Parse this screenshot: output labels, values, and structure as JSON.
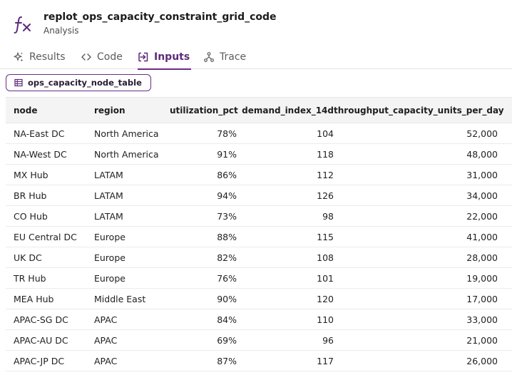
{
  "header": {
    "title": "replot_ops_capacity_constraint_grid_code",
    "subtitle": "Analysis",
    "icon": "function-fx-icon"
  },
  "tabs": [
    {
      "label": "Results",
      "icon": "sparkle-icon",
      "active": false
    },
    {
      "label": "Code",
      "icon": "code-icon",
      "active": false
    },
    {
      "label": "Inputs",
      "icon": "input-icon",
      "active": true
    },
    {
      "label": "Trace",
      "icon": "trace-icon",
      "active": false
    }
  ],
  "input_chip": {
    "label": "ops_capacity_node_table",
    "icon": "table-icon"
  },
  "table": {
    "columns": [
      "node",
      "region",
      "utilization_pct",
      "demand_index_14d",
      "throughput_capacity_units_per_day"
    ],
    "rows": [
      [
        "NA-East DC",
        "North America",
        "78%",
        "104",
        "52,000"
      ],
      [
        "NA-West DC",
        "North America",
        "91%",
        "118",
        "48,000"
      ],
      [
        "MX Hub",
        "LATAM",
        "86%",
        "112",
        "31,000"
      ],
      [
        "BR Hub",
        "LATAM",
        "94%",
        "126",
        "34,000"
      ],
      [
        "CO Hub",
        "LATAM",
        "73%",
        "98",
        "22,000"
      ],
      [
        "EU Central DC",
        "Europe",
        "88%",
        "115",
        "41,000"
      ],
      [
        "UK DC",
        "Europe",
        "82%",
        "108",
        "28,000"
      ],
      [
        "TR Hub",
        "Europe",
        "76%",
        "101",
        "19,000"
      ],
      [
        "MEA Hub",
        "Middle East",
        "90%",
        "120",
        "17,000"
      ],
      [
        "APAC-SG DC",
        "APAC",
        "84%",
        "110",
        "33,000"
      ],
      [
        "APAC-AU DC",
        "APAC",
        "69%",
        "96",
        "21,000"
      ],
      [
        "APAC-JP DC",
        "APAC",
        "87%",
        "117",
        "26,000"
      ]
    ]
  },
  "colors": {
    "accent": "#6b2d84",
    "header_bg": "#f4f4f5"
  }
}
